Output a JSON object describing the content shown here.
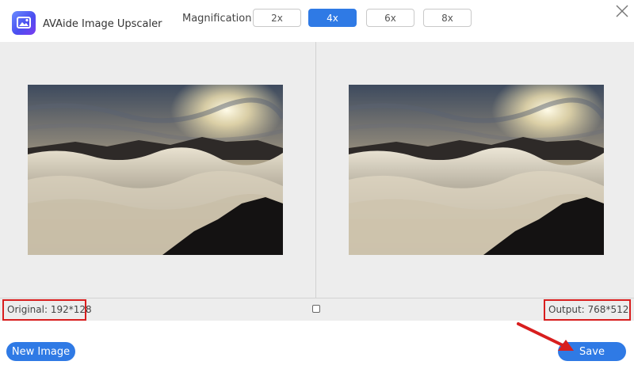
{
  "app": {
    "title": "AVAide Image Upscaler"
  },
  "magnification": {
    "label": "Magnification:",
    "options": [
      "2x",
      "4x",
      "6x",
      "8x"
    ],
    "selected": "4x"
  },
  "preview": {
    "original_label": "Original: 192*128",
    "output_label": "Output: 768*512"
  },
  "footer": {
    "new_image_label": "New Image",
    "save_label": "Save"
  },
  "colors": {
    "accent": "#2f7ae5",
    "highlight": "#d81e1e"
  },
  "icons": [
    "app-logo-icon",
    "close-icon",
    "compare-icon",
    "annotation-arrow-icon"
  ]
}
